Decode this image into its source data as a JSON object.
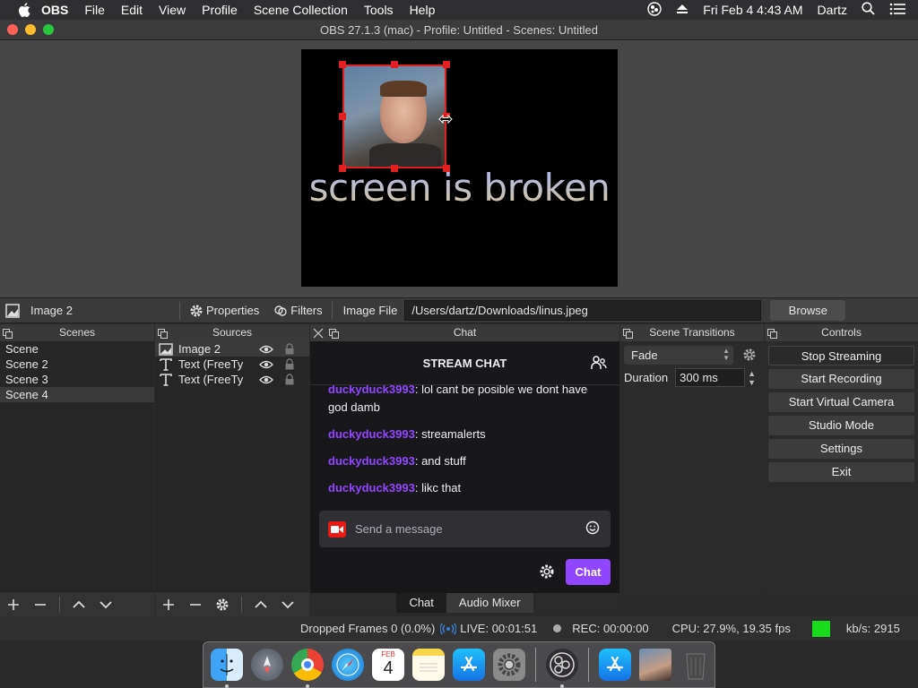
{
  "menubar": {
    "app_name": "OBS",
    "items": [
      "File",
      "Edit",
      "View",
      "Profile",
      "Scene Collection",
      "Tools",
      "Help"
    ],
    "datetime": "Fri Feb 4  4:43 AM",
    "user": "Dartz"
  },
  "window": {
    "title": "OBS 27.1.3 (mac) - Profile: Untitled - Scenes: Untitled"
  },
  "preview": {
    "overlay_text": "screen is broken"
  },
  "source_toolbar": {
    "selected_source": "Image 2",
    "properties_label": "Properties",
    "filters_label": "Filters",
    "image_file_label": "Image File",
    "image_file_path": "/Users/dartz/Downloads/linus.jpeg",
    "browse_label": "Browse"
  },
  "scenes": {
    "title": "Scenes",
    "items": [
      "Scene",
      "Scene 2",
      "Scene 3",
      "Scene 4"
    ],
    "selected": "Scene 4"
  },
  "sources": {
    "title": "Sources",
    "items": [
      "Image 2",
      "Text (FreeTy",
      "Text (FreeTy"
    ]
  },
  "chat": {
    "dock_title": "Chat",
    "header": "STREAM CHAT",
    "messages": [
      {
        "user": "duckyduck3993",
        "text": ": lol cant be posible we dont have god damb"
      },
      {
        "user": "duckyduck3993",
        "text": ": streamalerts"
      },
      {
        "user": "duckyduck3993",
        "text": ": and stuff"
      },
      {
        "user": "duckyduck3993",
        "text": ": likc that"
      }
    ],
    "input_placeholder": "Send a message",
    "send_label": "Chat"
  },
  "bottom_tabs": [
    "Chat",
    "Audio Mixer"
  ],
  "transitions": {
    "title": "Scene Transitions",
    "selected": "Fade",
    "duration_label": "Duration",
    "duration_value": "300 ms"
  },
  "controls": {
    "title": "Controls",
    "buttons": [
      "Stop Streaming",
      "Start Recording",
      "Start Virtual Camera",
      "Studio Mode",
      "Settings",
      "Exit"
    ]
  },
  "status": {
    "dropped_frames": "Dropped Frames 0 (0.0%)",
    "live": "LIVE: 00:01:51",
    "rec": "REC: 00:00:00",
    "cpu": "CPU: 27.9%, 19.35 fps",
    "kbs": "kb/s: 2915",
    "status_color": "#1adb1a"
  },
  "dock_apps": {
    "calendar_month": "FEB",
    "calendar_day": "4",
    "items": [
      "finder-icon",
      "launchpad-icon",
      "chrome-icon",
      "safari-icon",
      "calendar-icon",
      "notes-icon",
      "app-store-icon",
      "system-preferences-icon",
      "obs-icon",
      "app-store-folder-icon",
      "downloads-stack-icon",
      "trash-icon"
    ]
  }
}
